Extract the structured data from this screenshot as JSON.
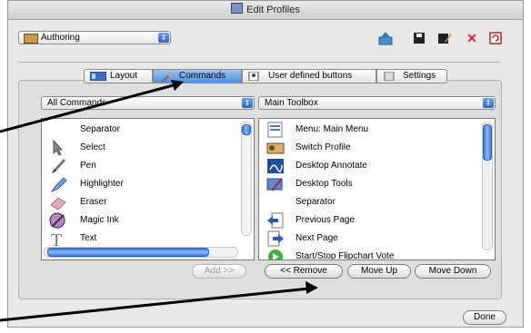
{
  "window": {
    "title": "Edit Profiles"
  },
  "profile": {
    "selected": "Authoring"
  },
  "toolbar": {
    "icons": [
      "upload-icon",
      "save-icon",
      "edit-icon",
      "delete-icon",
      "refresh-icon"
    ],
    "delete_color": "#e02020"
  },
  "tabs": [
    {
      "label": "Layout",
      "active": false
    },
    {
      "label": "Commands",
      "active": true
    },
    {
      "label": "User defined buttons",
      "active": false
    },
    {
      "label": "Settings",
      "active": false
    }
  ],
  "left_select": {
    "selected": "All Commands"
  },
  "right_select": {
    "selected": "Main Toolbox"
  },
  "left_list": [
    {
      "label": "Separator",
      "icon": "blank"
    },
    {
      "label": "Select",
      "icon": "cursor-icon"
    },
    {
      "label": "Pen",
      "icon": "pen-icon"
    },
    {
      "label": "Highlighter",
      "icon": "highlighter-icon"
    },
    {
      "label": "Eraser",
      "icon": "eraser-icon"
    },
    {
      "label": "Magic Ink",
      "icon": "magic-ink-icon"
    },
    {
      "label": "Text",
      "icon": "text-icon"
    }
  ],
  "right_list": [
    {
      "label": "Menu: Main Menu",
      "icon": "menu-icon"
    },
    {
      "label": "Switch Profile",
      "icon": "profile-icon"
    },
    {
      "label": "Desktop Annotate",
      "icon": "annotate-icon"
    },
    {
      "label": "Desktop Tools",
      "icon": "tools-icon"
    },
    {
      "label": "Separator",
      "icon": "blank"
    },
    {
      "label": "Previous Page",
      "icon": "prev-page-icon"
    },
    {
      "label": "Next Page",
      "icon": "next-page-icon"
    },
    {
      "label": "Start/Stop Flipchart Vote",
      "icon": "vote-icon"
    }
  ],
  "buttons": {
    "add": "Add >>",
    "remove": "<< Remove",
    "move_up": "Move Up",
    "move_down": "Move Down",
    "done": "Done"
  }
}
